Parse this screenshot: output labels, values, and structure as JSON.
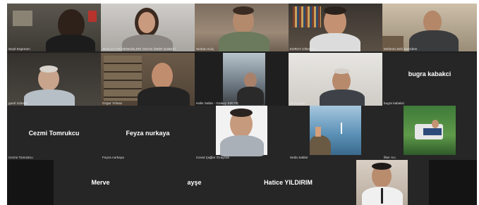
{
  "meeting": {
    "participants": [
      {
        "id": "p1",
        "name": "Seyit Ergemen",
        "kind": "video"
      },
      {
        "id": "p2",
        "name": "JEOLOJİ MÜHENDİSLERİ ODASI İZMİR ŞUBESİ",
        "kind": "video"
      },
      {
        "id": "p3",
        "name": "Serkan Kılıç",
        "kind": "video"
      },
      {
        "id": "p4",
        "name": "KORAY CİNAR(H)",
        "kind": "video"
      },
      {
        "id": "p5",
        "name": "Mehmet Zeki Saerdem",
        "kind": "video"
      },
      {
        "id": "p6",
        "name": "gurel özbekir",
        "kind": "video"
      },
      {
        "id": "p7",
        "name": "Ozgur Yılmaz",
        "kind": "video"
      },
      {
        "id": "p8",
        "name": "Halis Saltar - Galaxy S20 FE",
        "kind": "video"
      },
      {
        "id": "p9",
        "name": "Ali Kaptan",
        "kind": "video"
      },
      {
        "id": "p10",
        "name": "bugra kabakci",
        "label": "bugra kabakci",
        "kind": "avatar"
      },
      {
        "id": "p11",
        "name": "Cezmi Tomrukcu",
        "label": "Cezmi Tomrukcu",
        "kind": "avatar"
      },
      {
        "id": "p12",
        "name": "Feyza nurkaya",
        "label": "Feyza nurkaya",
        "kind": "avatar"
      },
      {
        "id": "p13",
        "name": "Cevat Çağlar Özaycan",
        "kind": "photo"
      },
      {
        "id": "p14",
        "name": "Seda Saklar",
        "kind": "photo"
      },
      {
        "id": "p15",
        "name": "İlker Acı",
        "kind": "photo"
      },
      {
        "id": "p16",
        "label": "Merve",
        "kind": "avatar"
      },
      {
        "id": "p17",
        "label": "ayşe",
        "kind": "avatar"
      },
      {
        "id": "p18",
        "label": "Hatice YILDIRIM",
        "kind": "avatar"
      },
      {
        "id": "p19",
        "kind": "photo"
      }
    ]
  },
  "colors": {
    "grid_background": "#1f1f1f",
    "tile_background": "#262626",
    "name_text": "#e8e8e8",
    "avatar_text": "#ffffff"
  }
}
